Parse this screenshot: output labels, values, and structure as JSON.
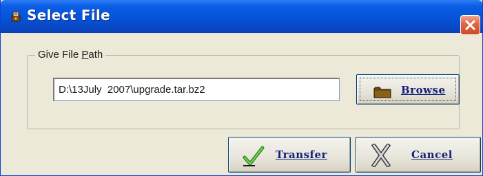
{
  "window": {
    "title": "Select File",
    "title_color": "#ffffff",
    "titlebar_color": "#0553d8",
    "icon": "app-icon",
    "close_icon": "close-icon"
  },
  "group": {
    "legend_prefix": "Give File ",
    "legend_mnemonic": "P",
    "legend_suffix": "ath"
  },
  "path_input": {
    "value": "D:\\13July  2007\\upgrade.tar.bz2"
  },
  "buttons": {
    "browse": {
      "label": "Browse",
      "icon": "folder-icon"
    },
    "transfer": {
      "label": "Transfer",
      "icon": "checkmark-icon"
    },
    "cancel": {
      "label": "Cancel",
      "icon": "x-cancel-icon"
    }
  },
  "colors": {
    "dialog_bg": "#ece9d8",
    "button_text": "#14207a",
    "close_button": "#e06a46"
  }
}
